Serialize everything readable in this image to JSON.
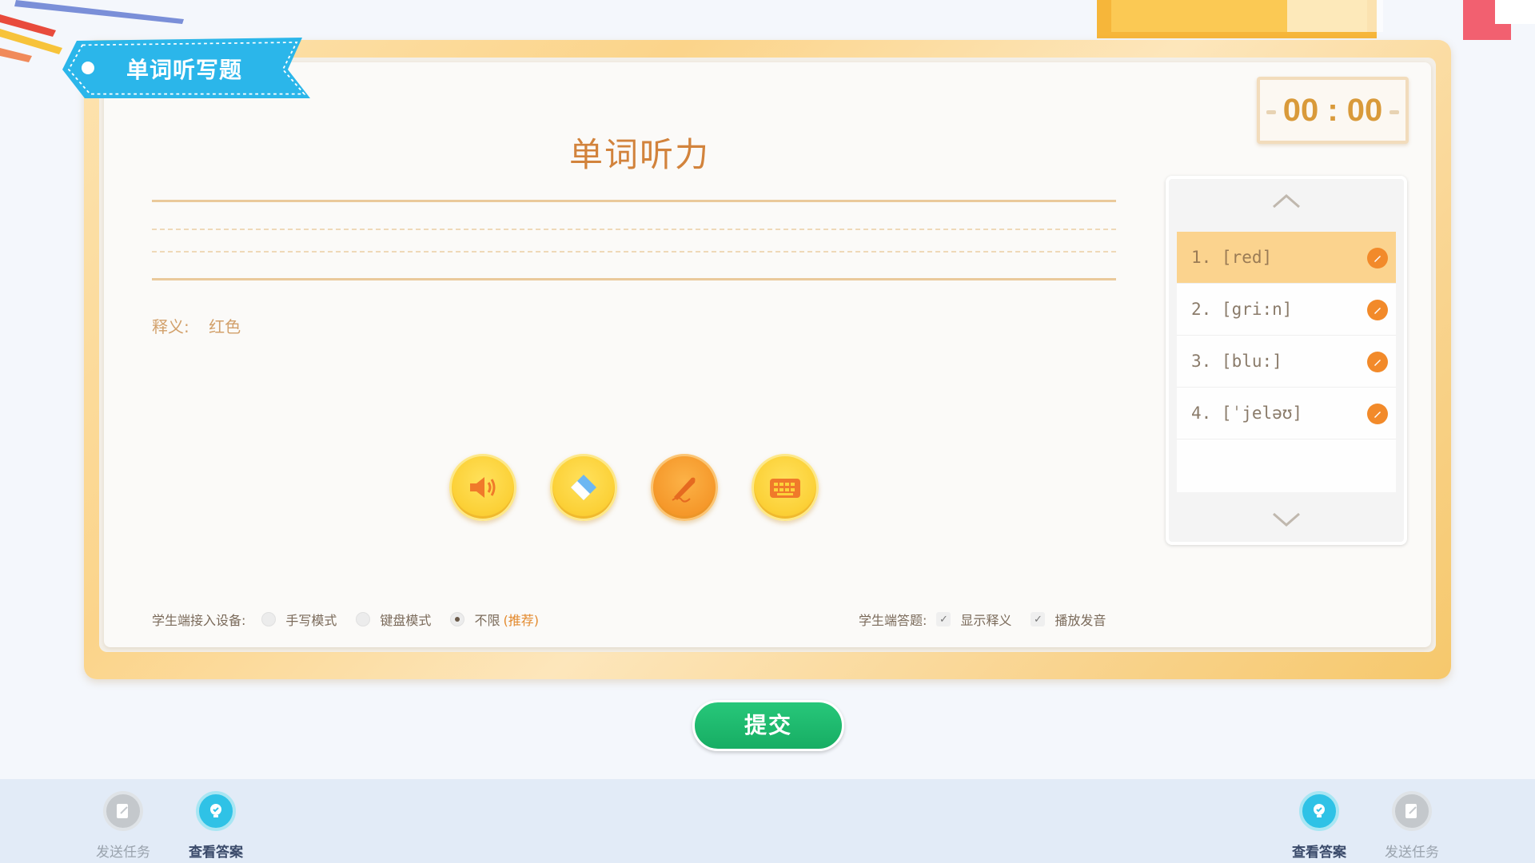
{
  "header": {
    "ribbon_title": "单词听写题",
    "timer": "00 : 00"
  },
  "question": {
    "title": "单词听力",
    "meaning_label": "释义:",
    "meaning_value": "红色"
  },
  "tools": [
    {
      "name": "speaker",
      "icon": "speaker-icon"
    },
    {
      "name": "eraser",
      "icon": "eraser-icon"
    },
    {
      "name": "handwriting",
      "icon": "pen-icon",
      "active": true
    },
    {
      "name": "keyboard",
      "icon": "keyboard-icon"
    }
  ],
  "word_list": {
    "items": [
      {
        "label": "1. [red]",
        "active": true
      },
      {
        "label": "2. [gri:n]"
      },
      {
        "label": "3. [blu:]"
      },
      {
        "label": "4. [ˈjeləʊ]"
      }
    ]
  },
  "input_device": {
    "label": "学生端接入设备:",
    "options": [
      {
        "label": "手写模式",
        "selected": false
      },
      {
        "label": "键盘模式",
        "selected": false
      },
      {
        "label": "不限",
        "selected": true,
        "note": "(推荐)"
      }
    ]
  },
  "answer_hint": {
    "label": "学生端答题:",
    "options": [
      {
        "label": "显示释义",
        "checked": true
      },
      {
        "label": "播放发音",
        "checked": true
      }
    ]
  },
  "submit_label": "提交",
  "bottom_bar": {
    "left": [
      {
        "label": "发送任务",
        "icon": "send-task-icon"
      },
      {
        "label": "查看答案",
        "icon": "view-answer-icon"
      }
    ],
    "right": [
      {
        "label": "查看答案",
        "icon": "view-answer-icon"
      },
      {
        "label": "发送任务",
        "icon": "send-task-icon"
      }
    ]
  },
  "colors": {
    "accent_orange": "#f28a2a",
    "title_orange": "#d2833c",
    "submit_green": "#1db56a",
    "ribbon_blue": "#2bb6ea"
  }
}
